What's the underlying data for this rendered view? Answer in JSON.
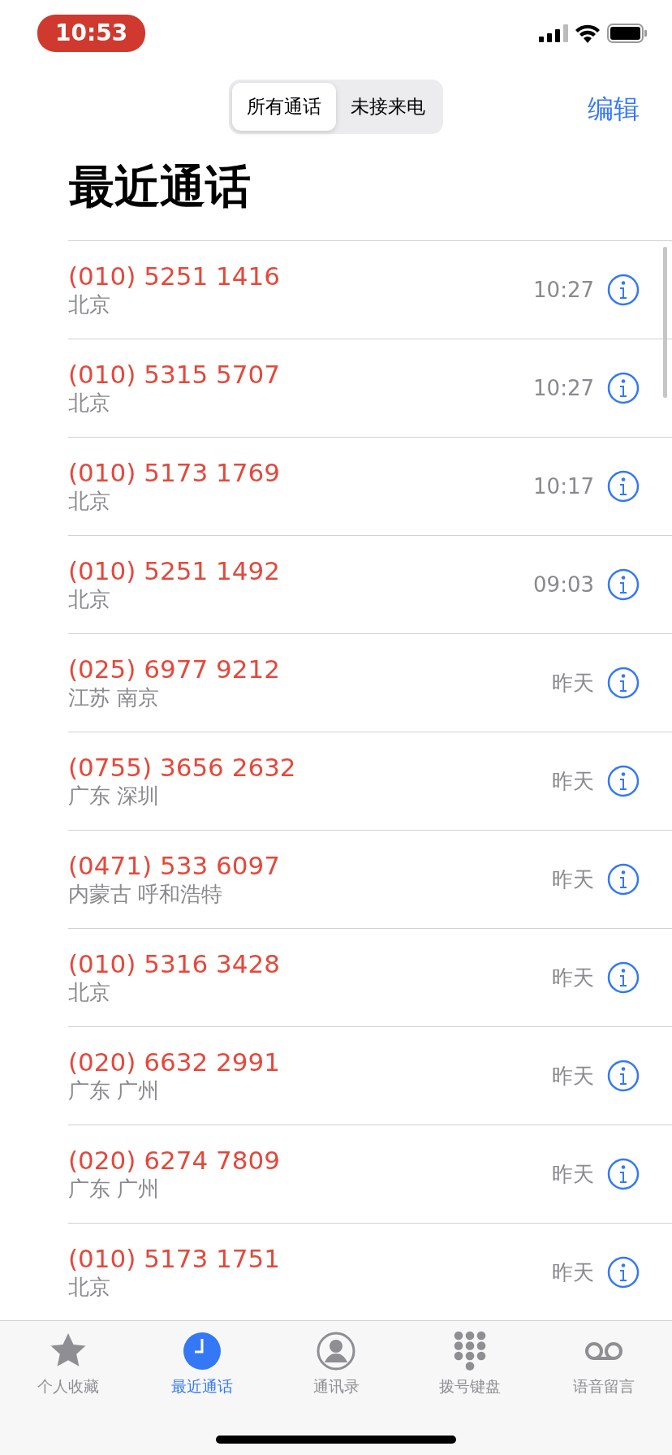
{
  "status_bar": {
    "time": "10:53"
  },
  "segments": [
    {
      "label": "所有通话",
      "selected": true
    },
    {
      "label": "未接来电",
      "selected": false
    }
  ],
  "edit_button": "编辑",
  "title": "最近通话",
  "calls": [
    {
      "number": "(010) 5251 1416",
      "location": "北京",
      "time": "10:27"
    },
    {
      "number": "(010) 5315 5707",
      "location": "北京",
      "time": "10:27"
    },
    {
      "number": "(010) 5173 1769",
      "location": "北京",
      "time": "10:17"
    },
    {
      "number": "(010) 5251 1492",
      "location": "北京",
      "time": "09:03"
    },
    {
      "number": "(025) 6977 9212",
      "location": "江苏 南京",
      "time": "昨天"
    },
    {
      "number": "(0755) 3656 2632",
      "location": "广东 深圳",
      "time": "昨天"
    },
    {
      "number": "(0471) 533 6097",
      "location": "内蒙古 呼和浩特",
      "time": "昨天"
    },
    {
      "number": "(010) 5316 3428",
      "location": "北京",
      "time": "昨天"
    },
    {
      "number": "(020) 6632 2991",
      "location": "广东 广州",
      "time": "昨天"
    },
    {
      "number": "(020) 6274 7809",
      "location": "广东 广州",
      "time": "昨天"
    },
    {
      "number": "(010) 5173 1751",
      "location": "北京",
      "time": "昨天"
    }
  ],
  "tab_bar": [
    {
      "kind": "star",
      "label": "个人收藏",
      "selected": false
    },
    {
      "kind": "clock",
      "label": "最近通话",
      "selected": true
    },
    {
      "kind": "person",
      "label": "通讯录",
      "selected": false
    },
    {
      "kind": "keypad",
      "label": "拨号键盘",
      "selected": false
    },
    {
      "kind": "voicemail",
      "label": "语音留言",
      "selected": false
    }
  ]
}
